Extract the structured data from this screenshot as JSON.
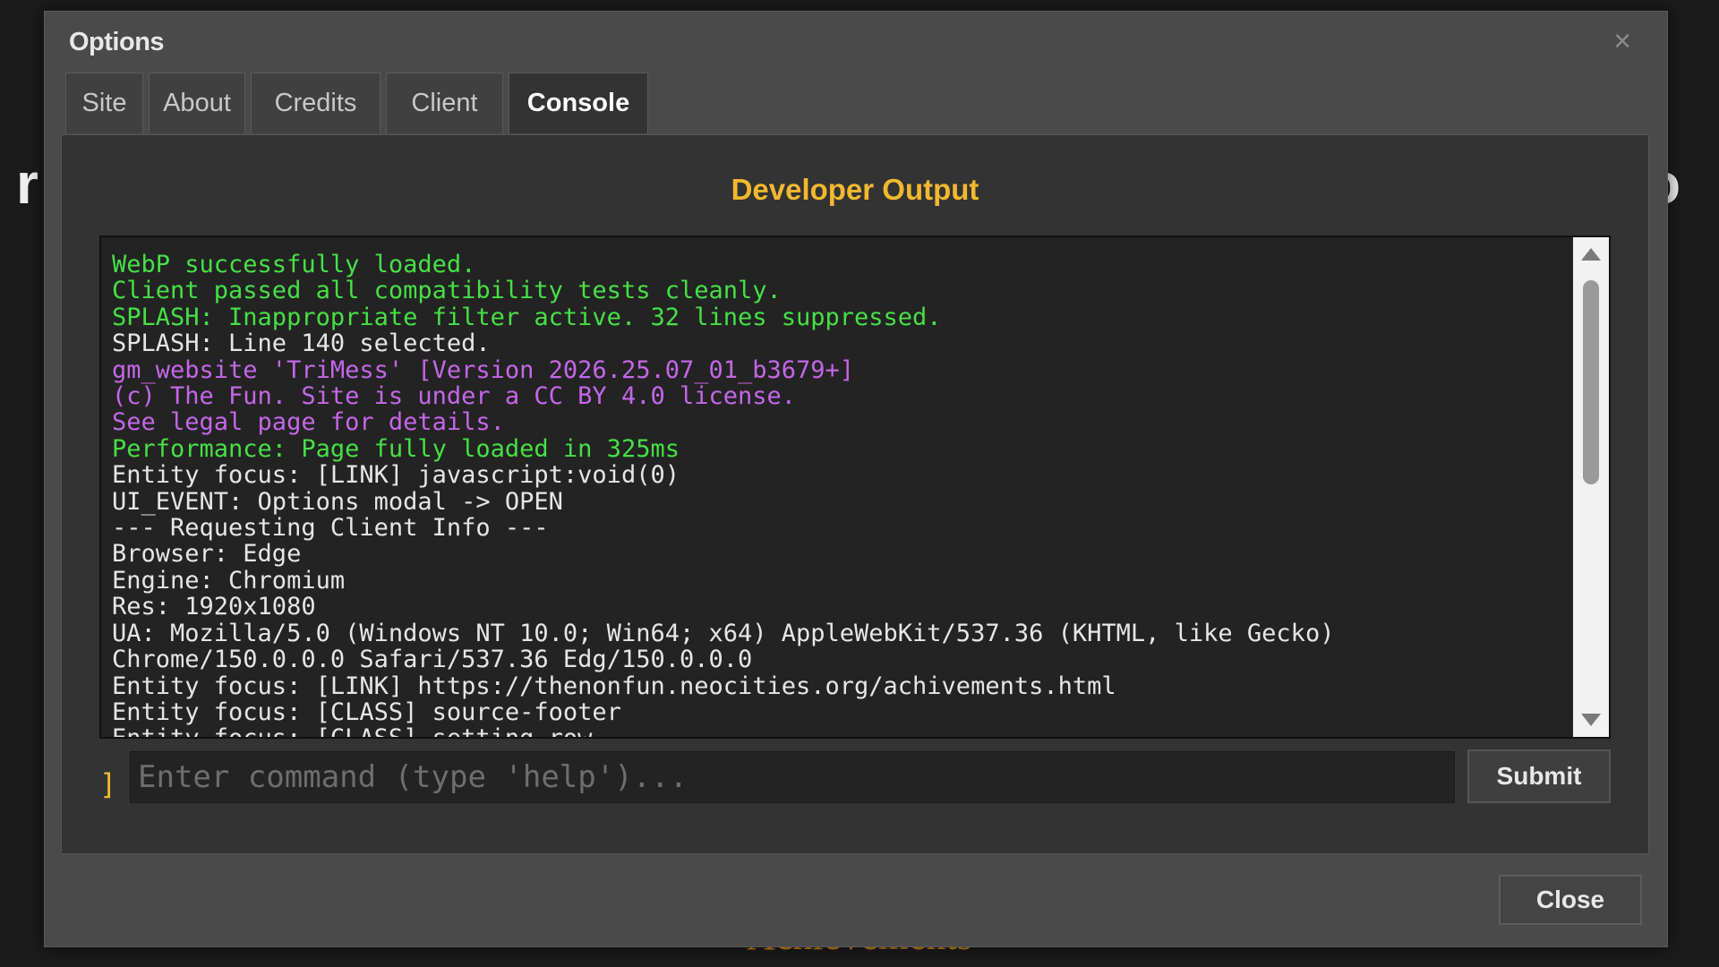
{
  "background": {
    "peek_left": "r",
    "peek_right": "o",
    "achievements_label": "Achievements"
  },
  "modal": {
    "title": "Options",
    "close_glyph": "×"
  },
  "tabs": [
    {
      "label": "Site",
      "active": false
    },
    {
      "label": "About",
      "active": false
    },
    {
      "label": "Credits",
      "active": false
    },
    {
      "label": "Client",
      "active": false
    },
    {
      "label": "Console",
      "active": true
    }
  ],
  "console": {
    "heading": "Developer Output",
    "lines": [
      {
        "text": "WebP successfully loaded.",
        "color": "#46e046"
      },
      {
        "text": "Client passed all compatibility tests cleanly.",
        "color": "#46e046"
      },
      {
        "text": "SPLASH: Inappropriate filter active. 32 lines suppressed.",
        "color": "#46e046"
      },
      {
        "text": "SPLASH: Line 140 selected.",
        "color": "#e6e6e6"
      },
      {
        "text": "gm_website 'TriMess' [Version 2026.25.07_01_b3679+]",
        "color": "#c467e8"
      },
      {
        "text": "(c) The Fun. Site is under a CC BY 4.0 license.",
        "color": "#c467e8"
      },
      {
        "text": "See legal page for details.",
        "color": "#c467e8"
      },
      {
        "text": "Performance: Page fully loaded in 325ms",
        "color": "#46e046"
      },
      {
        "text": "Entity focus: [LINK] javascript:void(0)",
        "color": "#e6e6e6"
      },
      {
        "text": "UI_EVENT: Options modal -> OPEN",
        "color": "#e6e6e6"
      },
      {
        "text": "--- Requesting Client Info ---",
        "color": "#e6e6e6"
      },
      {
        "text": "Browser: Edge",
        "color": "#e6e6e6"
      },
      {
        "text": "Engine: Chromium",
        "color": "#e6e6e6"
      },
      {
        "text": "Res: 1920x1080",
        "color": "#e6e6e6"
      },
      {
        "text": "UA: Mozilla/5.0 (Windows NT 10.0; Win64; x64) AppleWebKit/537.36 (KHTML, like Gecko)",
        "color": "#e6e6e6"
      },
      {
        "text": "Chrome/150.0.0.0 Safari/537.36 Edg/150.0.0.0",
        "color": "#e6e6e6"
      },
      {
        "text": "Entity focus: [LINK] https://thenonfun.neocities.org/achivements.html",
        "color": "#e6e6e6"
      },
      {
        "text": "Entity focus: [CLASS] source-footer",
        "color": "#e6e6e6"
      },
      {
        "text": "Entity focus: [CLASS] setting-row",
        "color": "#e6e6e6"
      }
    ],
    "prompt_glyph": "]",
    "input_value": "",
    "input_placeholder": "Enter command (type 'help')...",
    "submit_label": "Submit"
  },
  "footer": {
    "close_label": "Close"
  },
  "colors": {
    "accent": "#f2b82e",
    "success": "#46e046",
    "info": "#c467e8",
    "text": "#e6e6e6"
  },
  "icons": {
    "modal_close": "close-icon",
    "scroll_up": "scroll-up-arrow-icon",
    "scroll_down": "scroll-down-arrow-icon"
  }
}
